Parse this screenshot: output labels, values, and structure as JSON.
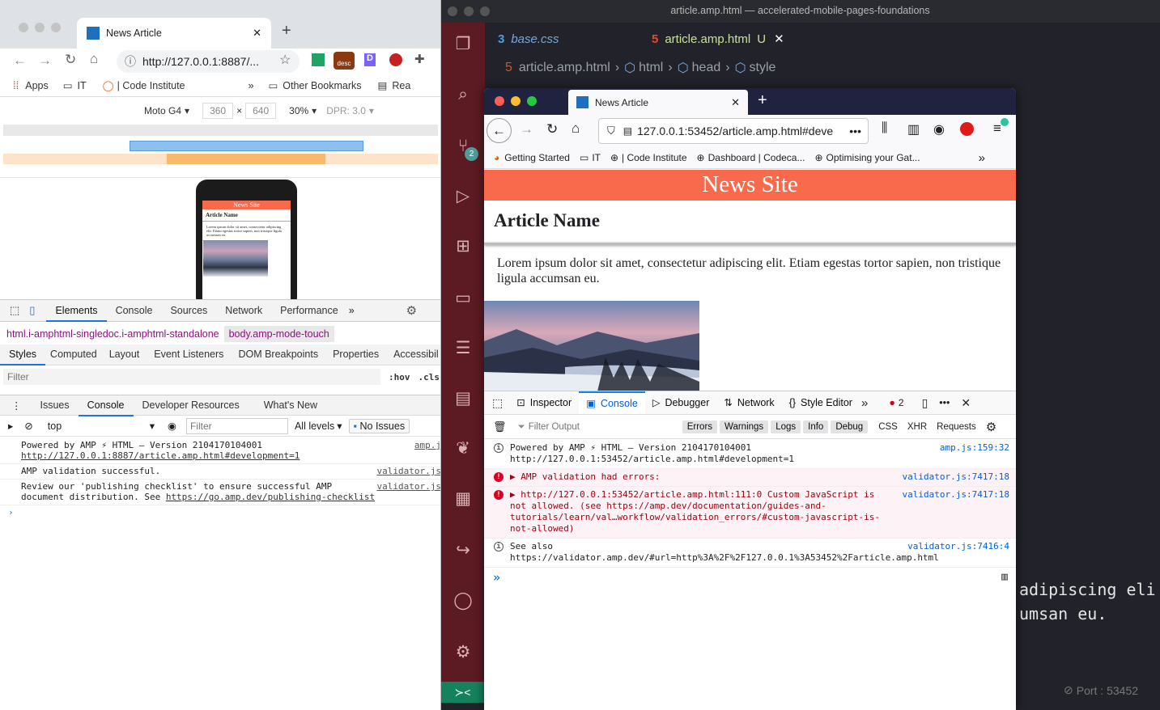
{
  "vscode": {
    "window_title": "article.amp.html — accelerated-mobile-pages-foundations",
    "tabs": [
      {
        "label": "base.css",
        "icon": "css-file-icon"
      },
      {
        "label": "article.amp.html",
        "modified": "U",
        "icon": "html-file-icon"
      }
    ],
    "breadcrumb": [
      "article.amp.html",
      "html",
      "head",
      "style"
    ],
    "scm_badge": "2",
    "code_lines": [
      "adipiscing eli",
      "umsan eu."
    ],
    "status_port": "Port : 53452",
    "accent_color": "#5c1a22"
  },
  "chrome": {
    "tab_title": "News Article",
    "url": "http://127.0.0.1:8887/...",
    "bookmarks": [
      "Apps",
      "IT",
      "| Code Institute",
      "Other Bookmarks",
      "Rea"
    ],
    "extension_badge": "desc",
    "device": "Moto G4",
    "width": "360",
    "height": "640",
    "zoom": "30%",
    "dpr": "DPR: 3.0",
    "phone_preview": {
      "header": "News Site",
      "title": "Article Name",
      "body": "Lorem ipsum dolor sit amet, consectetur adipiscing elit. Etiam egestas tortor sapien, non tristique ligula accumsan eu."
    },
    "devtools": {
      "tabs": [
        "Elements",
        "Console",
        "Sources",
        "Network",
        "Performance"
      ],
      "crumbs": [
        "html.i-amphtml-singledoc.i-amphtml-standalone",
        "body.amp-mode-touch"
      ],
      "subtabs": [
        "Styles",
        "Computed",
        "Layout",
        "Event Listeners",
        "DOM Breakpoints",
        "Properties",
        "Accessibil"
      ],
      "filter_placeholder": "Filter",
      "hov": ":hov",
      "cls": ".cls",
      "drawer_tabs": [
        "Issues",
        "Console",
        "Developer Resources",
        "What's New"
      ],
      "context": "top",
      "console_filter": "Filter",
      "levels": "All levels",
      "issues": "No Issues",
      "logs": [
        {
          "text": "Powered by AMP ⚡ HTML – Version 2104170104001 ",
          "link": "http://127.0.0.1:8887/article.amp.html#development=1",
          "source": "amp.j"
        },
        {
          "text": "AMP validation successful.",
          "link": "",
          "source": "validator.js"
        },
        {
          "text": "Review our 'publishing checklist' to ensure successful AMP document distribution. See ",
          "link": "https://go.amp.dev/publishing-checklist",
          "source": "validator.js"
        }
      ]
    }
  },
  "firefox": {
    "tab_title": "News Article",
    "url": "127.0.0.1:53452/article.amp.html#deve",
    "bookmarks": [
      "Getting Started",
      "IT",
      "| Code Institute",
      "Dashboard | Codeca...",
      "Optimising your Gat..."
    ],
    "page": {
      "site_title": "News Site",
      "article_title": "Article Name",
      "body": "Lorem ipsum dolor sit amet, consectetur adipiscing elit. Etiam egestas tortor sapien, non tristique ligula accumsan eu.",
      "header_color": "#f96a4d"
    },
    "devtools": {
      "tabs": [
        "Inspector",
        "Console",
        "Debugger",
        "Network",
        "Style Editor"
      ],
      "error_count": "2",
      "filter_placeholder": "Filter Output",
      "levels": [
        "Errors",
        "Warnings",
        "Logs",
        "Info",
        "Debug"
      ],
      "types": [
        "CSS",
        "XHR",
        "Requests"
      ],
      "logs": [
        {
          "kind": "info",
          "text": "Powered by AMP ⚡ HTML – Version 2104170104001 http://127.0.0.1:53452/article.amp.html#development=1",
          "source": "amp.js:159:32"
        },
        {
          "kind": "error",
          "text": "▶ AMP validation had errors:",
          "source": "validator.js:7417:18"
        },
        {
          "kind": "error",
          "text": "▶ http://127.0.0.1:53452/article.amp.html:111:0 Custom JavaScript is not allowed. (see https://amp.dev/documentation/guides-and-tutorials/learn/val…workflow/validation_errors/#custom-javascript-is-not-allowed)",
          "source": "validator.js:7417:18"
        },
        {
          "kind": "info",
          "text": "See also https://validator.amp.dev/#url=http%3A%2F%2F127.0.0.1%3A53452%2Farticle.amp.html",
          "source": "validator.js:7416:4"
        }
      ]
    }
  }
}
